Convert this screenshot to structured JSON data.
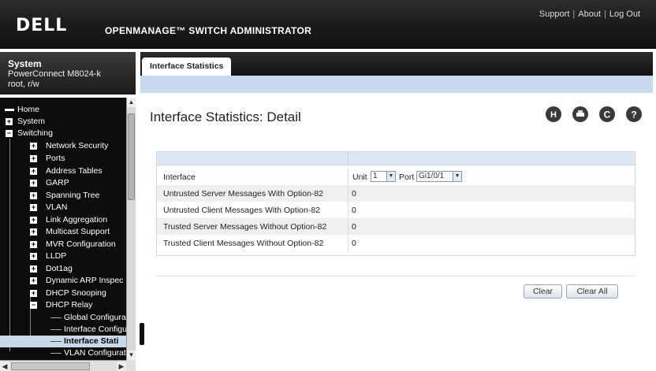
{
  "header": {
    "logo": "DELL",
    "product": "OPENMANAGE™ SWITCH ADMINISTRATOR",
    "links": [
      "Support",
      "About",
      "Log Out"
    ]
  },
  "system": {
    "title": "System",
    "model": "PowerConnect M8024-k",
    "user": "root, r/w"
  },
  "nav": {
    "home": "Home",
    "system": "System",
    "switching": "Switching",
    "network_security": "Network Security",
    "ports": "Ports",
    "address_tables": "Address Tables",
    "garp": "GARP",
    "spanning_tree": "Spanning Tree",
    "vlan": "VLAN",
    "link_aggregation": "Link Aggregation",
    "multicast_support": "Multicast Support",
    "mvr_configuration": "MVR Configuration",
    "lldp": "LLDP",
    "dot1ag": "Dot1ag",
    "dynamic_arp": "Dynamic ARP Inspec",
    "dhcp_snooping": "DHCP Snooping",
    "dhcp_relay": "DHCP Relay",
    "global_config": "Global Configura",
    "interface_config": "Interface Configu",
    "interface_stats": "Interface Stati",
    "vlan_config": "VLAN Configurat"
  },
  "tab": {
    "label": "Interface Statistics"
  },
  "page": {
    "title": "Interface Statistics: Detail"
  },
  "icons": [
    "save-icon",
    "print-icon",
    "refresh-icon",
    "help-icon"
  ],
  "table": {
    "rows": [
      {
        "label": "Interface",
        "unit_label": "Unit",
        "unit_value": "1",
        "port_label": "Port",
        "port_value": "Gi1/0/1"
      },
      {
        "label": "Untrusted Server Messages With Option-82",
        "value": "0"
      },
      {
        "label": "Untrusted Client Messages With Option-82",
        "value": "0"
      },
      {
        "label": "Trusted Server Messages Without Option-82",
        "value": "0"
      },
      {
        "label": "Trusted Client Messages Without Option-82",
        "value": "0"
      }
    ]
  },
  "buttons": {
    "clear": "Clear",
    "clear_all": "Clear All"
  },
  "colors": {
    "header_bg": "#1c1c1c",
    "accent_strip": "#c9daee",
    "table_header": "#dfe8f2",
    "selected_nav": "#c8d8ea"
  }
}
